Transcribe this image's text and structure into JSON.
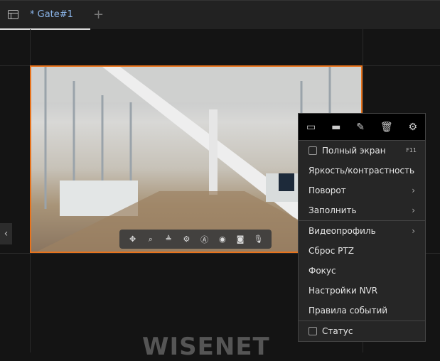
{
  "tabbar": {
    "tab_label": "* Gate#1",
    "add_label": "+"
  },
  "ptz_toolbar": [
    "move-icon",
    "zoom-area-icon",
    "image-adjust-icon",
    "settings-adjust-icon",
    "text-overlay-icon",
    "record-icon",
    "snapshot-icon",
    "microphone-icon"
  ],
  "logo": "WISENET",
  "context_menu": {
    "header_icons": [
      "window-icon",
      "maximize-icon",
      "edit-icon",
      "delete-icon",
      "gear-icon"
    ],
    "fullscreen": {
      "label": "Полный экран",
      "shortcut": "F11",
      "checked": false
    },
    "brightness": "Яркость/контрастность",
    "rotate": "Поворот",
    "fill": "Заполнить",
    "video_profile": "Видеопрофиль",
    "ptz_reset": "Сброс PTZ",
    "focus": "Фокус",
    "nvr_settings": "Настройки NVR",
    "event_rules": "Правила событий",
    "status": {
      "label": "Статус",
      "checked": false
    },
    "chevron": "›"
  },
  "colors": {
    "accent": "#e8731c"
  }
}
